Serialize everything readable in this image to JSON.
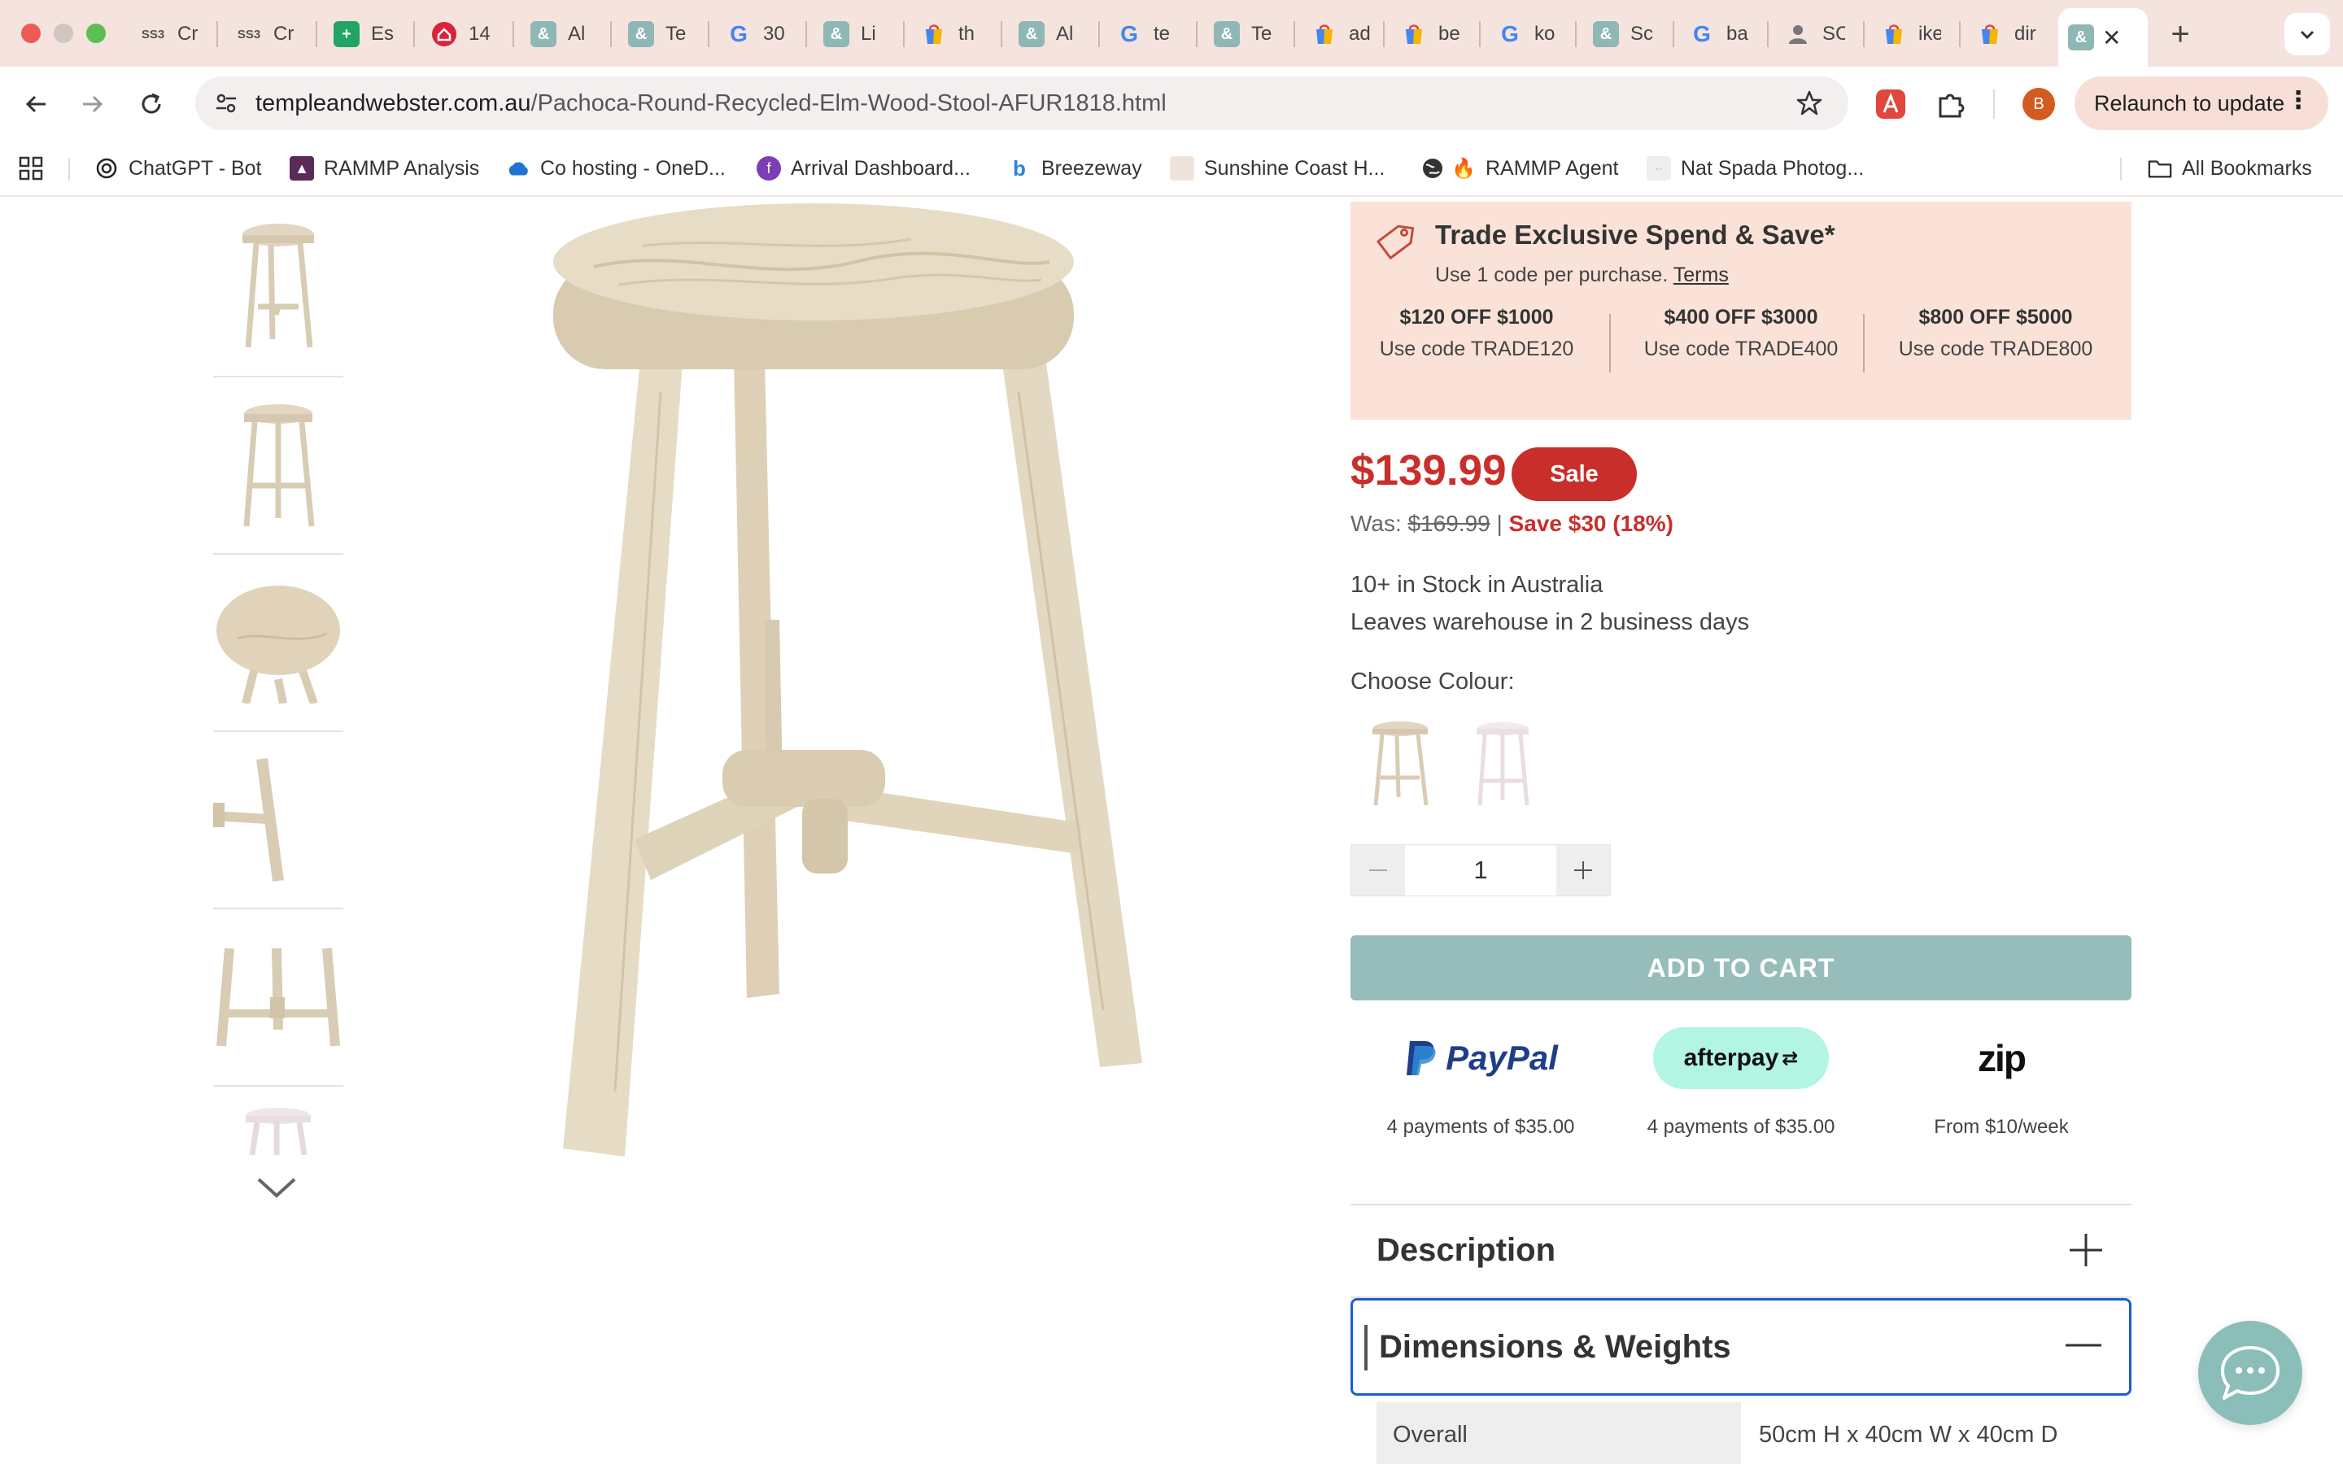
{
  "browser": {
    "tabs": [
      {
        "label": "Cr",
        "icon": "ss3-icon"
      },
      {
        "label": "Cr",
        "icon": "ss3-icon"
      },
      {
        "label": "Es",
        "icon": "sheets-icon"
      },
      {
        "label": "14",
        "icon": "home-icon"
      },
      {
        "label": "Al",
        "icon": "ampersand-icon"
      },
      {
        "label": "Te",
        "icon": "ampersand-icon"
      },
      {
        "label": "30",
        "icon": "google-icon"
      },
      {
        "label": "Li",
        "icon": "ampersand-icon"
      },
      {
        "label": "th",
        "icon": "shop-icon"
      },
      {
        "label": "Al",
        "icon": "ampersand-icon"
      },
      {
        "label": "te",
        "icon": "google-icon"
      },
      {
        "label": "Te",
        "icon": "ampersand-icon"
      },
      {
        "label": "ad",
        "icon": "shop-icon"
      },
      {
        "label": "be",
        "icon": "shop-icon"
      },
      {
        "label": "ko",
        "icon": "google-icon"
      },
      {
        "label": "Sc",
        "icon": "ampersand-icon"
      },
      {
        "label": "ba",
        "icon": "google-icon"
      },
      {
        "label": "SC",
        "icon": "person-icon"
      },
      {
        "label": "ike",
        "icon": "shop-icon"
      },
      {
        "label": "dir",
        "icon": "shop-icon"
      }
    ],
    "new_tab": "+",
    "url_domain": "templeandwebster.com.au",
    "url_path": "/Pachoca-Round-Recycled-Elm-Wood-Stool-AFUR1818.html",
    "profile_initial": "B",
    "relaunch_label": "Relaunch to update",
    "relaunch_dots": "⋮",
    "bookmarks": [
      "ChatGPT - Bot",
      "RAMMP Analysis",
      "Co hosting - OneD...",
      "Arrival Dashboard...",
      "Breezeway",
      "Sunshine Coast H...",
      "RAMMP Agent",
      "Nat Spada Photog..."
    ],
    "all_bookmarks": "All Bookmarks"
  },
  "promo": {
    "title": "Trade Exclusive Spend & Save*",
    "subtitle": "Use 1 code per purchase.",
    "terms_link": "Terms",
    "offers": [
      {
        "amount": "$120 OFF $1000",
        "code": "Use code TRADE120"
      },
      {
        "amount": "$400 OFF $3000",
        "code": "Use code TRADE400"
      },
      {
        "amount": "$800 OFF $5000",
        "code": "Use code TRADE800"
      }
    ]
  },
  "product": {
    "price": "$139.99",
    "sale_badge": "Sale",
    "was_label": "Was:",
    "was_price": "$169.99",
    "separator": "|",
    "save_text": "Save $30 (18%)",
    "stock_line1": "10+ in Stock in Australia",
    "stock_line2": "Leaves warehouse in 2 business days",
    "choose_colour": "Choose Colour:",
    "quantity": "1",
    "add_to_cart": "ADD TO CART"
  },
  "payments": [
    {
      "name": "PayPal",
      "text": "4 payments of $35.00"
    },
    {
      "name": "afterpay",
      "text": "4 payments of $35.00"
    },
    {
      "name": "zip",
      "text": "From $10/week"
    }
  ],
  "accordion": {
    "description": "Description",
    "dimensions": "Dimensions & Weights",
    "rows": [
      {
        "label": "Overall",
        "value": "50cm H x 40cm W x 40cm D"
      }
    ]
  },
  "colors": {
    "sale_red": "#c92f2a",
    "cart_teal": "#96bdb9",
    "promo_bg": "#fbe2d8",
    "tab_strip": "#f5e3dd",
    "focus_blue": "#1a5fd1",
    "chat_teal": "#8cbeb9"
  }
}
